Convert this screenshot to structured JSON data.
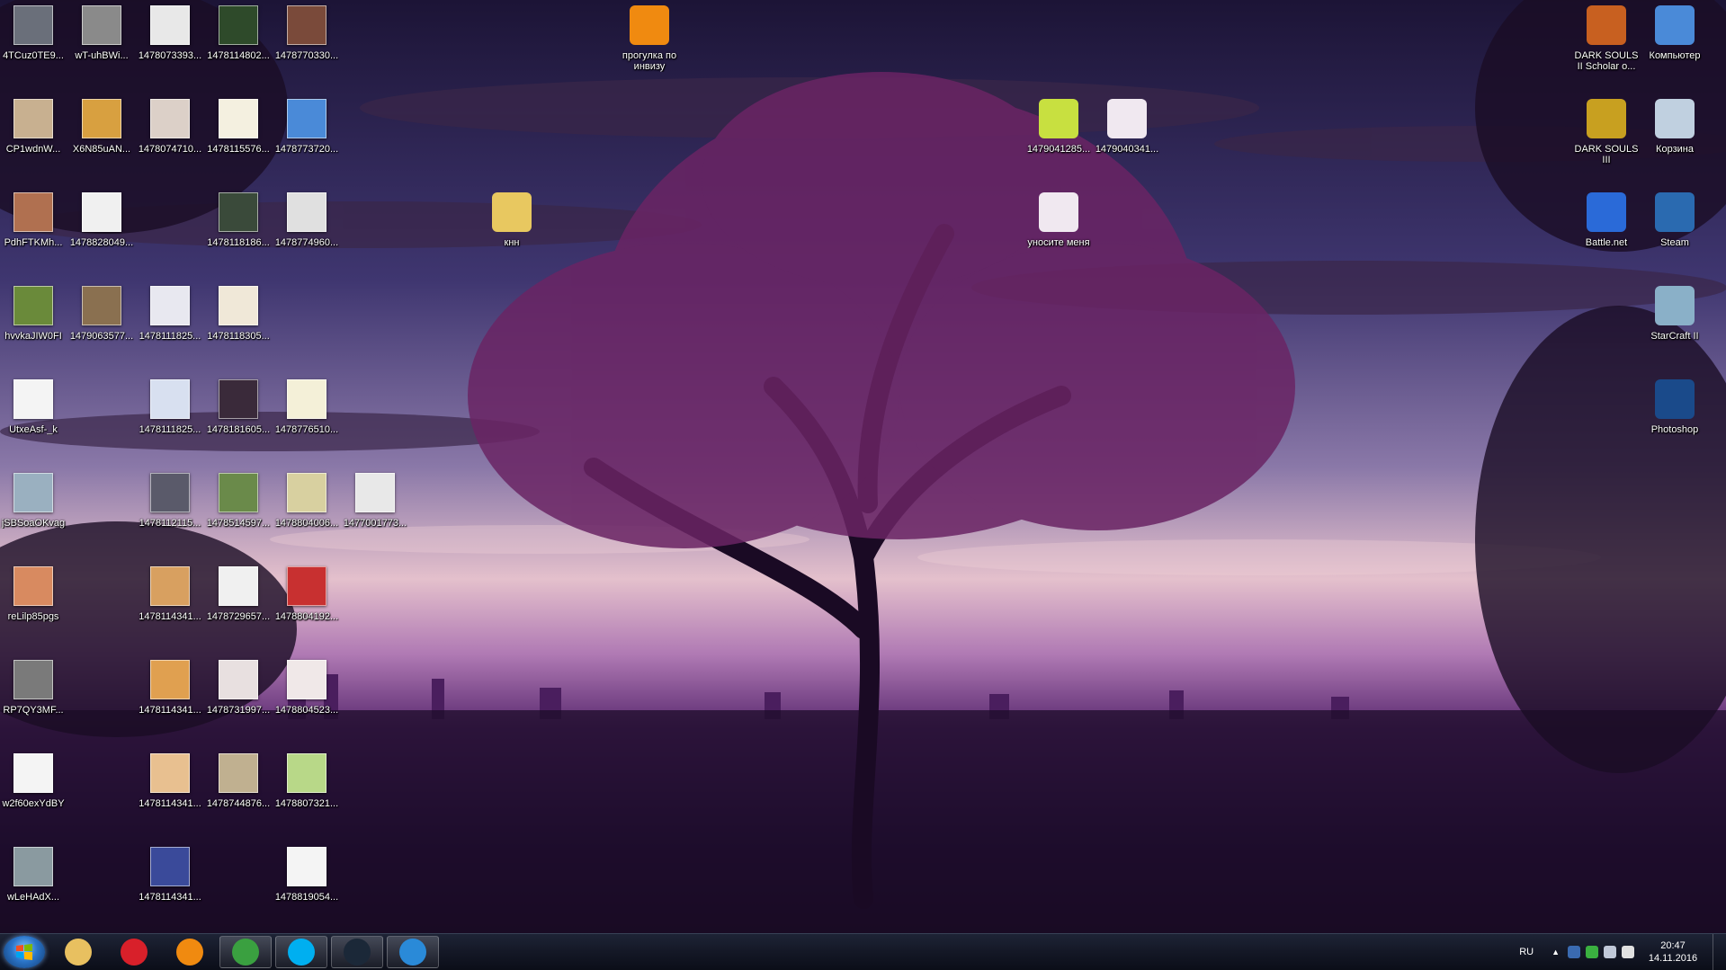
{
  "desktop": {
    "icons_left": [
      {
        "label": "4TCuz0TE9...",
        "color": "#6a6f7a"
      },
      {
        "label": "wT-uhBWi...",
        "color": "#8a8a8a"
      },
      {
        "label": "1478073393...",
        "color": "#e8e8e8"
      },
      {
        "label": "1478114802...",
        "color": "#2e4a2a"
      },
      {
        "label": "1478770330...",
        "color": "#7a4a3a"
      },
      {
        "label": "CP1wdnW...",
        "color": "#c8b090"
      },
      {
        "label": "X6N85uAN...",
        "color": "#d8a040"
      },
      {
        "label": "1478074710...",
        "color": "#dcd0c8"
      },
      {
        "label": "1478115576...",
        "color": "#f4f0e0"
      },
      {
        "label": "1478773720...",
        "color": "#4a8ad8"
      },
      {
        "label": "PdhFTKMh...",
        "color": "#b07050"
      },
      {
        "label": "1478828049...",
        "color": "#f0f0f0"
      },
      {
        "label": "1478118186...",
        "color": "#3a4a3a"
      },
      {
        "label": "1478774960...",
        "color": "#e0e0e0"
      },
      {
        "label": "hvvkaJIW0FI",
        "color": "#6a8a3a"
      },
      {
        "label": "1479063577...",
        "color": "#8a7050"
      },
      {
        "label": "1478111825...",
        "color": "#e8e8f0"
      },
      {
        "label": "1478118305...",
        "color": "#f0e8d8"
      },
      {
        "label": "UtxeAsf-_k",
        "color": "#f4f4f4"
      },
      {
        "label": "1478111825...",
        "color": "#d8e0f0"
      },
      {
        "label": "1478181605...",
        "color": "#3a2a3a"
      },
      {
        "label": "1478776510...",
        "color": "#f4f0d8"
      },
      {
        "label": "jSBSoaOKvag",
        "color": "#9ab0c0"
      },
      {
        "label": "1478112115...",
        "color": "#5a5a6a"
      },
      {
        "label": "1478514597...",
        "color": "#6a8a4a"
      },
      {
        "label": "1478804006...",
        "color": "#d8d0a0"
      },
      {
        "label": "1477001773...",
        "color": "#e8e8e8"
      },
      {
        "label": "reLilp85pgs",
        "color": "#d88a60"
      },
      {
        "label": "1478114341...",
        "color": "#d8a060"
      },
      {
        "label": "1478729657...",
        "color": "#f0f0f0"
      },
      {
        "label": "1478804192...",
        "color": "#c83030"
      },
      {
        "label": "RP7QY3MF...",
        "color": "#7a7a7a"
      },
      {
        "label": "1478114341...",
        "color": "#e0a050"
      },
      {
        "label": "1478731997...",
        "color": "#e8e0e0"
      },
      {
        "label": "1478804523...",
        "color": "#f0e8e8"
      },
      {
        "label": "w2f60exYdBY",
        "color": "#f4f4f4"
      },
      {
        "label": "1478114341...",
        "color": "#e8c090"
      },
      {
        "label": "1478744876...",
        "color": "#c0b090"
      },
      {
        "label": "1478807321...",
        "color": "#b8d888"
      },
      {
        "label": "wLeHAdX...",
        "color": "#8a9aa0"
      },
      {
        "label": "1478114341...",
        "color": "#3a4a9a"
      },
      {
        "label": "1478819054...",
        "color": "#f4f4f4"
      }
    ],
    "icons_center": [
      {
        "label": "прогулка по инвизу",
        "color": "#f08a10"
      },
      {
        "label": "кнн",
        "color": "#e8c860"
      },
      {
        "label": "1479041285...",
        "color": "#c8e040"
      },
      {
        "label": "1479040341...",
        "color": "#f0e8f0"
      },
      {
        "label": "уносите меня",
        "color": "#f0e8f0"
      }
    ],
    "icons_right": [
      {
        "label": "DARK SOULS II Scholar o...",
        "color": "#c86020"
      },
      {
        "label": "Компьютер",
        "color": "#4a8ad8"
      },
      {
        "label": "DARK SOULS III",
        "color": "#c8a020"
      },
      {
        "label": "Корзина",
        "color": "#c0d0e0"
      },
      {
        "label": "Battle.net",
        "color": "#2a6ad8"
      },
      {
        "label": "Steam",
        "color": "#2a6ab0"
      },
      {
        "label": "StarCraft II",
        "color": "#8ab0c8"
      },
      {
        "label": "Photoshop",
        "color": "#1a4a8a"
      }
    ]
  },
  "taskbar": {
    "pinned": [
      {
        "name": "explorer",
        "icon": "folder-icon",
        "color": "#e8c060"
      },
      {
        "name": "opera",
        "icon": "opera-icon",
        "color": "#d8202a"
      },
      {
        "name": "vlc",
        "icon": "vlc-icon",
        "color": "#f08a10"
      },
      {
        "name": "chrome",
        "icon": "chrome-icon",
        "color": "#3aa040"
      },
      {
        "name": "skype",
        "icon": "skype-icon",
        "color": "#00aff0"
      },
      {
        "name": "steam",
        "icon": "steam-icon",
        "color": "#1b2838"
      },
      {
        "name": "battlenet",
        "icon": "battlenet-icon",
        "color": "#2a8ad8"
      }
    ],
    "language": "RU",
    "time": "20:47",
    "date": "14.11.2016"
  }
}
